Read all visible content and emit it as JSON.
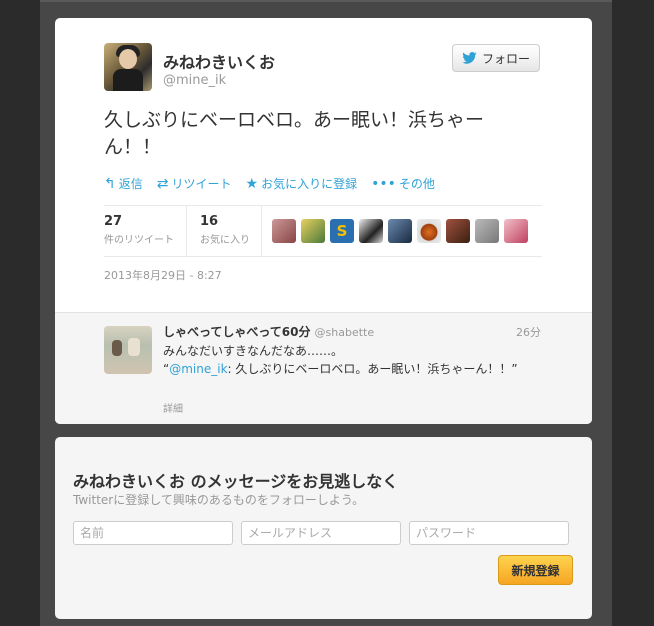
{
  "tweet": {
    "user_name": "みねわきいくお",
    "handle": "@mine_ik",
    "follow_label": "フォロー",
    "text": "久しぶりにベーロベロ。あー眠い！浜ちゃーん！！",
    "actions": {
      "reply": "返信",
      "retweet": "リツイート",
      "favorite": "お気に入りに登録",
      "more": "その他"
    },
    "stats": {
      "retweets_count": "27",
      "retweets_label": "件のリツイート",
      "favorites_count": "16",
      "favorites_label": "お気に入り"
    },
    "date": "2013年8月29日 - 8:27"
  },
  "reply": {
    "user_name": "しゃべってしゃべって60分",
    "handle": "@shabette",
    "time": "26分",
    "line1": "みんなだいすきなんだなあ……。",
    "quote_open": "“",
    "quote_link": "@mine_ik",
    "quote_text": ": 久しぶりにベーロベロ。あー眠い！浜ちゃーん！！”",
    "detail": "詳細"
  },
  "signup": {
    "title": "みねわきいくお のメッセージをお見逃しなく",
    "subtitle": "Twitterに登録して興味のあるものをフォローしよう。",
    "name_placeholder": "名前",
    "email_placeholder": "メールアドレス",
    "password_placeholder": "パスワード",
    "submit_label": "新規登録"
  },
  "colors": {
    "accent": "#2fa2d6",
    "button": "#f5a623",
    "background": "#2b2b2b"
  },
  "icons": [
    "twitter-bird-icon",
    "reply-icon",
    "retweet-icon",
    "star-icon",
    "more-dots-icon"
  ]
}
